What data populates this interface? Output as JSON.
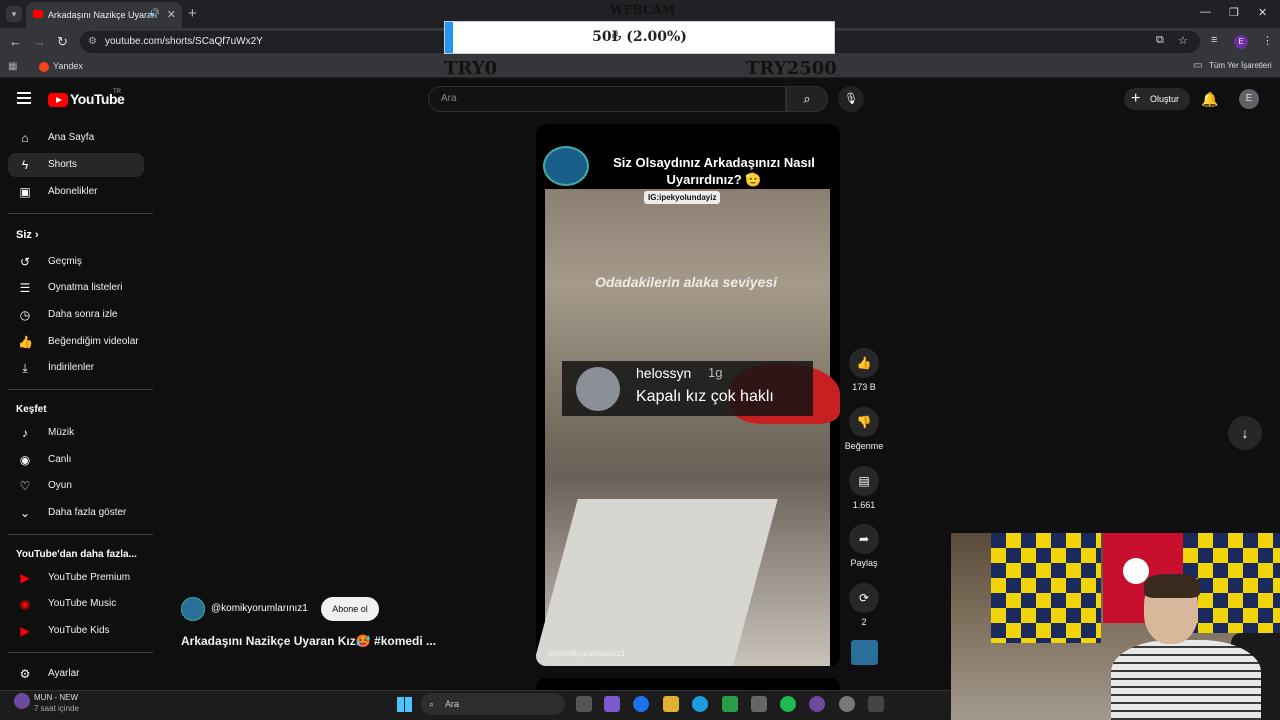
{
  "browser": {
    "tab_title": "Arkadaşını Nazikçe Uyaran",
    "url": "youtube.com/shorts/SCaQf7uWx2Y",
    "bookmark_yandex": "Yandex",
    "bookmark_all": "Tüm Yer İşaretleri"
  },
  "overlay": {
    "webcam_label": "WEBCAM",
    "goal_text": "50₺ (2.00%)",
    "goal_progress": 0.02,
    "goal_start": "TRY0",
    "goal_end": "TRY2500"
  },
  "header": {
    "logo_text": "YouTube",
    "country": "TR",
    "search_placeholder": "Ara",
    "create_label": "Oluştur",
    "avatar_letter": "E"
  },
  "sidebar": {
    "items": [
      {
        "label": "Ana Sayfa",
        "icon": "home-icon"
      },
      {
        "label": "Shorts",
        "icon": "shorts-icon"
      },
      {
        "label": "Abonelikler",
        "icon": "subscriptions-icon"
      }
    ],
    "you_heading": "Siz",
    "you_items": [
      {
        "label": "Geçmiş",
        "icon": "history-icon"
      },
      {
        "label": "Oynatma listeleri",
        "icon": "playlists-icon"
      },
      {
        "label": "Daha sonra izle",
        "icon": "watch-later-icon"
      },
      {
        "label": "Beğendiğim videolar",
        "icon": "liked-icon"
      },
      {
        "label": "İndirilenler",
        "icon": "download-icon"
      }
    ],
    "explore_heading": "Keşfet",
    "explore_items": [
      {
        "label": "Müzik",
        "icon": "music-icon"
      },
      {
        "label": "Canlı",
        "icon": "live-icon"
      },
      {
        "label": "Oyun",
        "icon": "gaming-icon"
      },
      {
        "label": "Daha fazla göster",
        "icon": "chevron-down-icon"
      }
    ],
    "more_heading": "YouTube'dan daha fazla...",
    "more_items": [
      {
        "label": "YouTube Premium"
      },
      {
        "label": "YouTube Music"
      },
      {
        "label": "YouTube Kids"
      }
    ],
    "settings_label": "Ayarlar"
  },
  "short": {
    "title": "Siz Olsaydınız Arkadaşınızı Nasıl Uyarırdınız? 🫡",
    "ig_tag": "IG:ipekyolundayiz",
    "caption": "Odadakilerin alaka seviyesi",
    "comment_user": "helossyn",
    "comment_time": "1g",
    "comment_text": "Kapalı kız çok haklı",
    "watermark": "@komikyorumlarınız1"
  },
  "actions": {
    "likes": "173 B",
    "dislike_label": "Beğenme",
    "comments": "1.661",
    "share_label": "Paylaş",
    "remix_count": "2"
  },
  "channel": {
    "handle": "@komikyorumlarınız1",
    "subscribe_label": "Abone ol",
    "video_title": "Arkadaşını Nazikçe Uyaran Kız🥵 #komedi ..."
  },
  "taskbar": {
    "weather_line1": "MUN - NEW",
    "weather_line2": "7 saat içinde",
    "search_placeholder": "Ara"
  }
}
